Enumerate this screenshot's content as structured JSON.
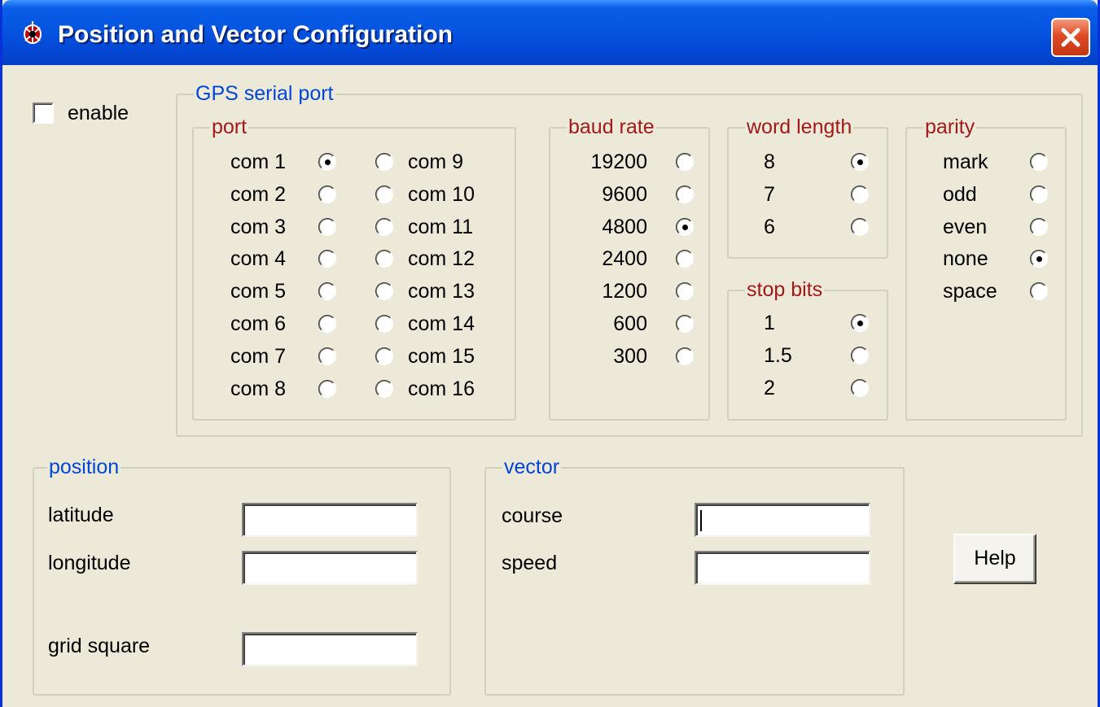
{
  "window": {
    "title": "Position and Vector Configuration",
    "close_label": "×"
  },
  "enable": {
    "label": "enable",
    "checked": false
  },
  "gps_group": {
    "title": "GPS serial port"
  },
  "port": {
    "title": "port",
    "selected": "com 1",
    "left": [
      "com 1",
      "com 2",
      "com 3",
      "com 4",
      "com 5",
      "com 6",
      "com 7",
      "com 8"
    ],
    "right": [
      "com 9",
      "com 10",
      "com 11",
      "com 12",
      "com 13",
      "com 14",
      "com 15",
      "com 16"
    ]
  },
  "baud_rate": {
    "title": "baud rate",
    "selected": "4800",
    "options": [
      "19200",
      "9600",
      "4800",
      "2400",
      "1200",
      "600",
      "300"
    ]
  },
  "word_length": {
    "title": "word length",
    "selected": "8",
    "options": [
      "8",
      "7",
      "6"
    ]
  },
  "stop_bits": {
    "title": "stop bits",
    "selected": "1",
    "options": [
      "1",
      "1.5",
      "2"
    ]
  },
  "parity": {
    "title": "parity",
    "selected": "none",
    "options": [
      "mark",
      "odd",
      "even",
      "none",
      "space"
    ]
  },
  "position": {
    "title": "position",
    "latitude_label": "latitude",
    "latitude_value": "",
    "longitude_label": "longitude",
    "longitude_value": "",
    "grid_label": "grid square",
    "grid_value": ""
  },
  "vector": {
    "title": "vector",
    "course_label": "course",
    "course_value": "",
    "speed_label": "speed",
    "speed_value": ""
  },
  "help_label": "Help",
  "colors": {
    "title_bar": "#0553e0",
    "face": "#ece9d8",
    "group_title_blue": "#0046d5",
    "group_title_red": "#a11a1a",
    "close_button": "#e04a25"
  }
}
